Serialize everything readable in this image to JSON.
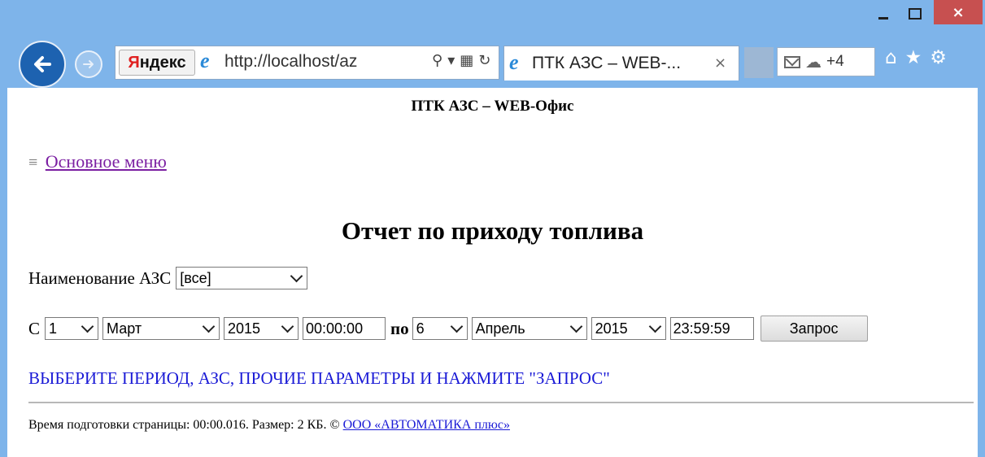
{
  "window": {
    "minimize_label": "",
    "close_label": "×"
  },
  "browser": {
    "search_brand": "Яндекс",
    "search_brand_first": "Я",
    "search_brand_rest": "ндекс",
    "url": "http://localhost/az",
    "tab_title": "ПТК АЗС – WEB-...",
    "tab_close": "×",
    "notification_count": "+4",
    "icons": [
      "back-arrow-icon",
      "forward-arrow-icon",
      "ie-logo-icon",
      "search-icon",
      "compat-view-icon",
      "refresh-icon",
      "mail-icon",
      "cloud-icon",
      "home-icon",
      "star-icon",
      "gear-icon"
    ]
  },
  "page": {
    "site_title": "ПТК АЗС – WEB-Офис",
    "menu_icon": "≡",
    "menu_link": "Основное меню",
    "report_title": "Отчет по приходу топлива",
    "azs_label": "Наименование АЗС",
    "azs_value": "[все]",
    "from_label": "С",
    "from_day": "1",
    "from_month": "Март",
    "from_year": "2015",
    "from_time": "00:00:00",
    "to_label": "по",
    "to_day": "6",
    "to_month": "Апрель",
    "to_year": "2015",
    "to_time": "23:59:59",
    "query_button": "Запрос",
    "prompt": "ВЫБЕРИТЕ ПЕРИОД, АЗС, ПРОЧИЕ ПАРАМЕТРЫ И НАЖМИТЕ \"ЗАПРОС\"",
    "footer_text": "Время подготовки страницы: 00:00.016. Размер: 2 КБ. © ",
    "footer_link": "ООО «АВТОМАТИКА плюс»"
  },
  "colors": {
    "frame": "#7eb4ea",
    "link_visited": "#7b1fa2",
    "prompt": "#1a1ad6",
    "close_button": "#c75050"
  }
}
